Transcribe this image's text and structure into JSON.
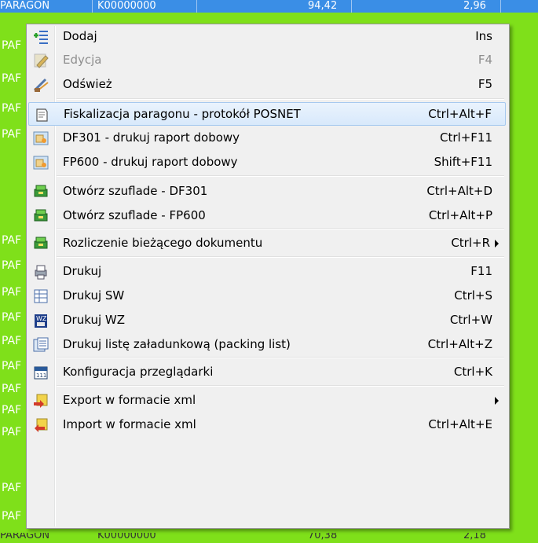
{
  "background": {
    "top_row": {
      "type": "PARAGON",
      "number": "K00000000",
      "amount": "94,42",
      "value": "2,96"
    },
    "row_prefix": "PAF",
    "bottom_row": {
      "type": "PARAGON",
      "number": "K00000000",
      "amount": "70,38",
      "value": "2,18"
    }
  },
  "menu": {
    "items": [
      {
        "label": "Dodaj",
        "shortcut": "Ins",
        "icon": "add-list-icon",
        "enabled": true
      },
      {
        "label": "Edycja",
        "shortcut": "F4",
        "icon": "edit-pencil-icon",
        "enabled": false
      },
      {
        "label": "Odśwież",
        "shortcut": "F5",
        "icon": "refresh-icon",
        "enabled": true
      },
      {
        "label": "Fiskalizacja paragonu - protokół POSNET",
        "shortcut": "Ctrl+Alt+F",
        "icon": "receipt-icon",
        "enabled": true,
        "highlighted": true
      },
      {
        "label": "DF301 - drukuj raport dobowy",
        "shortcut": "Ctrl+F11",
        "icon": "report-icon",
        "enabled": true
      },
      {
        "label": "FP600 - drukuj raport dobowy",
        "shortcut": "Shift+F11",
        "icon": "report-icon",
        "enabled": true
      },
      {
        "label": "Otwórz szuflade - DF301",
        "shortcut": "Ctrl+Alt+D",
        "icon": "cash-drawer-icon",
        "enabled": true
      },
      {
        "label": "Otwórz szuflade - FP600",
        "shortcut": "Ctrl+Alt+P",
        "icon": "cash-drawer-icon",
        "enabled": true
      },
      {
        "label": "Rozliczenie bieżącego dokumentu",
        "shortcut": "Ctrl+R",
        "icon": "cash-drawer-icon",
        "enabled": true,
        "submenu": true
      },
      {
        "label": "Drukuj",
        "shortcut": "F11",
        "icon": "printer-icon",
        "enabled": true
      },
      {
        "label": "Drukuj SW",
        "shortcut": "Ctrl+S",
        "icon": "table-icon",
        "enabled": true
      },
      {
        "label": "Drukuj WZ",
        "shortcut": "Ctrl+W",
        "icon": "wz-document-icon",
        "enabled": true
      },
      {
        "label": "Drukuj listę załadunkową (packing list)",
        "shortcut": "Ctrl+Alt+Z",
        "icon": "packing-list-icon",
        "enabled": true
      },
      {
        "label": "Konfiguracja przeglądarki",
        "shortcut": "Ctrl+K",
        "icon": "calendar-config-icon",
        "enabled": true
      },
      {
        "label": "Export w formacie xml",
        "shortcut": "",
        "icon": "export-icon",
        "enabled": true,
        "submenu": true
      },
      {
        "label": "Import w formacie xml",
        "shortcut": "Ctrl+Alt+E",
        "icon": "import-icon",
        "enabled": true
      }
    ]
  }
}
